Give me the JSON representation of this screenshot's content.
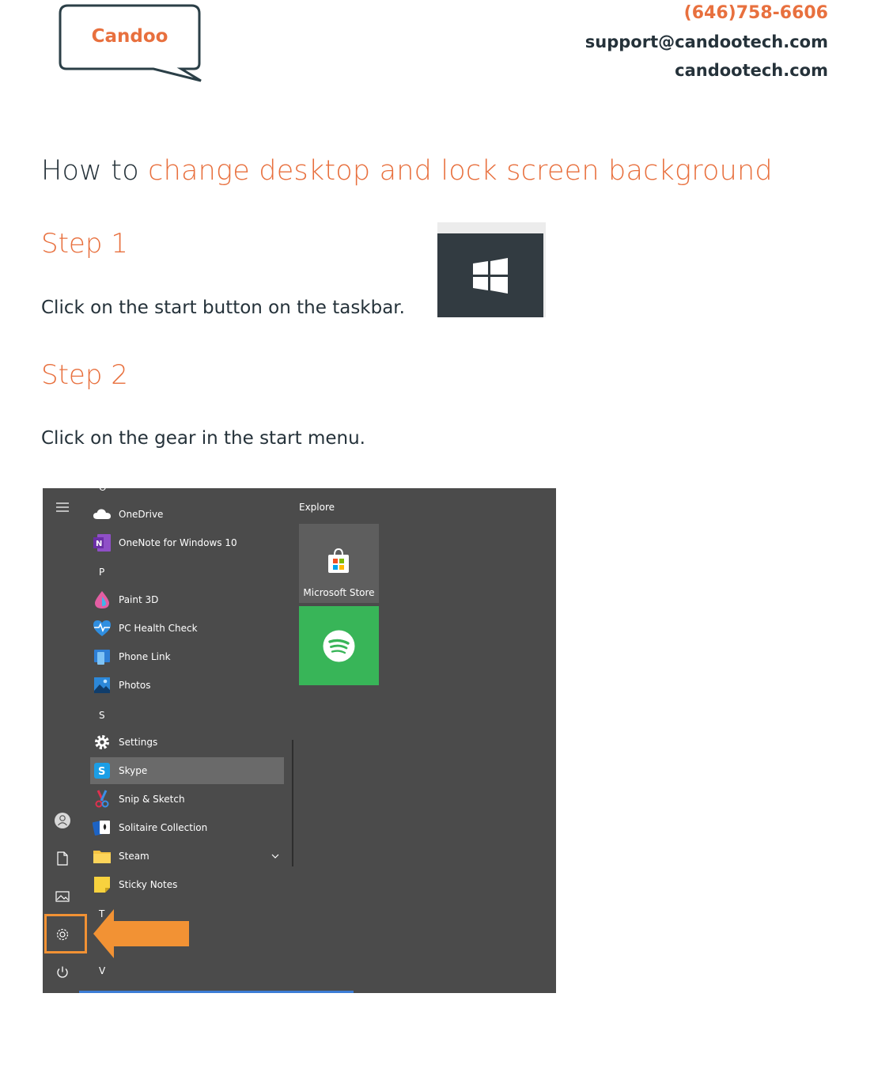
{
  "logo": {
    "text": "Candoo"
  },
  "contact": {
    "phone": "(646)758-6606",
    "email": "support@candootech.com",
    "website": "candootech.com"
  },
  "title": {
    "prefix": "How to ",
    "accent": "change desktop and lock screen background"
  },
  "step1": {
    "heading": "Step 1",
    "text": "Click on the start button on the taskbar."
  },
  "step2": {
    "heading": "Step 2",
    "text": "Click on the gear in the start menu."
  },
  "start_menu": {
    "top_letter": "O",
    "apps": [
      {
        "label": "OneDrive",
        "icon": "onedrive-icon"
      },
      {
        "label": "OneNote for Windows 10",
        "icon": "onenote-icon"
      },
      {
        "label": "Paint 3D",
        "icon": "paint3d-icon"
      },
      {
        "label": "PC Health Check",
        "icon": "pc-health-icon"
      },
      {
        "label": "Phone Link",
        "icon": "phone-link-icon"
      },
      {
        "label": "Photos",
        "icon": "photos-icon"
      },
      {
        "label": "Settings",
        "icon": "gear-icon"
      },
      {
        "label": "Skype",
        "icon": "skype-icon"
      },
      {
        "label": "Snip & Sketch",
        "icon": "snip-sketch-icon"
      },
      {
        "label": "Solitaire Collection",
        "icon": "solitaire-icon"
      },
      {
        "label": "Steam",
        "icon": "folder-icon"
      },
      {
        "label": "Sticky Notes",
        "icon": "sticky-notes-icon"
      }
    ],
    "letters": {
      "p": "P",
      "s": "S",
      "t": "T",
      "v": "V"
    },
    "explore_label": "Explore",
    "tiles": [
      {
        "label": "Microsoft Store",
        "icon": "store-icon"
      },
      {
        "label": "",
        "icon": "spotify-icon"
      }
    ],
    "colors": {
      "accent_arrow": "#f29234",
      "spotify": "#38b558"
    }
  }
}
